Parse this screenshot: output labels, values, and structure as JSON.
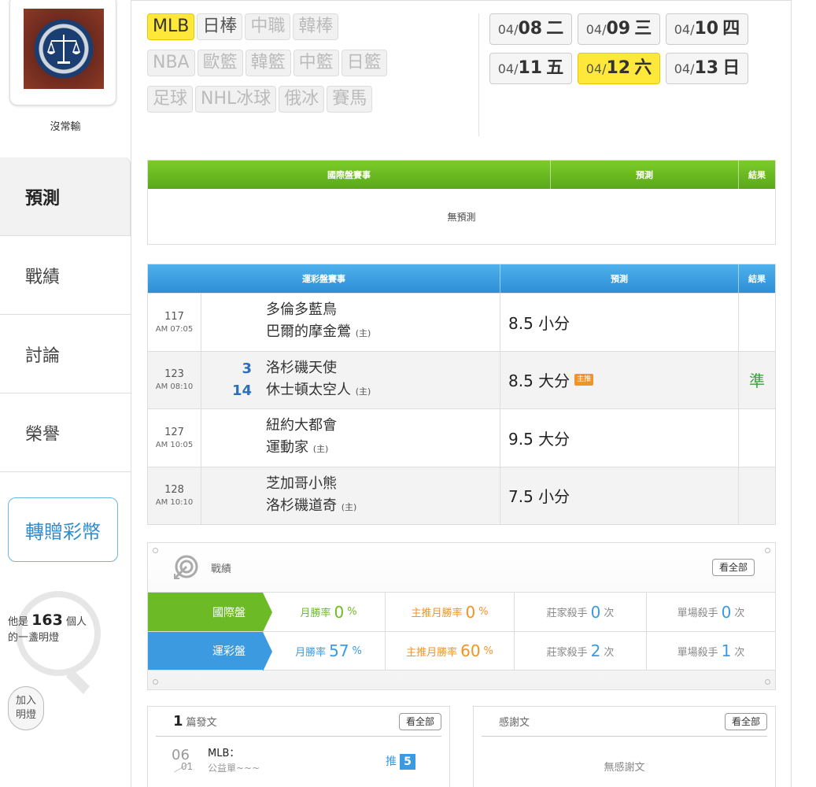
{
  "profile": {
    "username": "沒常輸"
  },
  "nav": {
    "items": [
      "預測",
      "戰績",
      "討論",
      "榮譽"
    ]
  },
  "gift_button": "轉贈彩幣",
  "lamp": {
    "prefix": "他是",
    "count": "163",
    "suffix": "個人",
    "line2": "的一盞明燈"
  },
  "join_button": {
    "line1": "加入",
    "line2": "明燈"
  },
  "sports": {
    "row1": [
      "MLB",
      "日棒",
      "中職",
      "韓棒"
    ],
    "row2": [
      "NBA",
      "歐籃",
      "韓籃",
      "中籃",
      "日籃"
    ],
    "row3": [
      "足球",
      "NHL冰球",
      "俄冰",
      "賽馬"
    ]
  },
  "dates": [
    {
      "md": "04/",
      "day": "08",
      "wd": "二"
    },
    {
      "md": "04/",
      "day": "09",
      "wd": "三"
    },
    {
      "md": "04/",
      "day": "10",
      "wd": "四"
    },
    {
      "md": "04/",
      "day": "11",
      "wd": "五"
    },
    {
      "md": "04/",
      "day": "12",
      "wd": "六"
    },
    {
      "md": "04/",
      "day": "13",
      "wd": "日"
    }
  ],
  "intl_table": {
    "headers": [
      "國際盤賽事",
      "預測",
      "結果"
    ],
    "empty": "無預測"
  },
  "lottery_table": {
    "headers": [
      "運彩盤賽事",
      "預測",
      "結果"
    ],
    "rows": [
      {
        "no": "117",
        "time": "AM 07:05",
        "score1": "",
        "score2": "",
        "away": "多倫多藍鳥",
        "home": "巴爾的摩金鶯",
        "home_tag": "(主)",
        "pred": "8.5 小分",
        "badge": "",
        "result": ""
      },
      {
        "no": "123",
        "time": "AM 08:10",
        "score1": "3",
        "score2": "14",
        "away": "洛杉磯天使",
        "home": "休士頓太空人",
        "home_tag": "(主)",
        "pred": "8.5 大分",
        "badge": "主推",
        "result": "準"
      },
      {
        "no": "127",
        "time": "AM 10:05",
        "score1": "",
        "score2": "",
        "away": "紐約大都會",
        "home": "運動家",
        "home_tag": "(主)",
        "pred": "9.5 大分",
        "badge": "",
        "result": ""
      },
      {
        "no": "128",
        "time": "AM 10:10",
        "score1": "",
        "score2": "",
        "away": "芝加哥小熊",
        "home": "洛杉磯道奇",
        "home_tag": "(主)",
        "pred": "7.5 小分",
        "badge": "",
        "result": ""
      }
    ]
  },
  "record": {
    "title": "戰績",
    "see_all": "看全部",
    "rows": [
      {
        "label": "國際盤",
        "month_label": "月勝率",
        "month": "0",
        "main_label": "主推月勝率",
        "main": "0",
        "pct": "%",
        "banker_label": "莊家殺手",
        "banker": "0",
        "single_label": "單場殺手",
        "single": "0",
        "times": "次"
      },
      {
        "label": "運彩盤",
        "month_label": "月勝率",
        "month": "57",
        "main_label": "主推月勝率",
        "main": "60",
        "pct": "%",
        "banker_label": "莊家殺手",
        "banker": "2",
        "single_label": "單場殺手",
        "single": "1",
        "times": "次"
      }
    ]
  },
  "posts": {
    "count": "1",
    "label": "篇發文",
    "see_all": "看全部",
    "item": {
      "d1": "06",
      "d2": "01",
      "title": "MLB：",
      "subtitle": "公益單~~~",
      "push_label": "推",
      "push_count": "5"
    }
  },
  "thanks": {
    "label": "感謝文",
    "see_all": "看全部",
    "empty": "無感謝文"
  }
}
